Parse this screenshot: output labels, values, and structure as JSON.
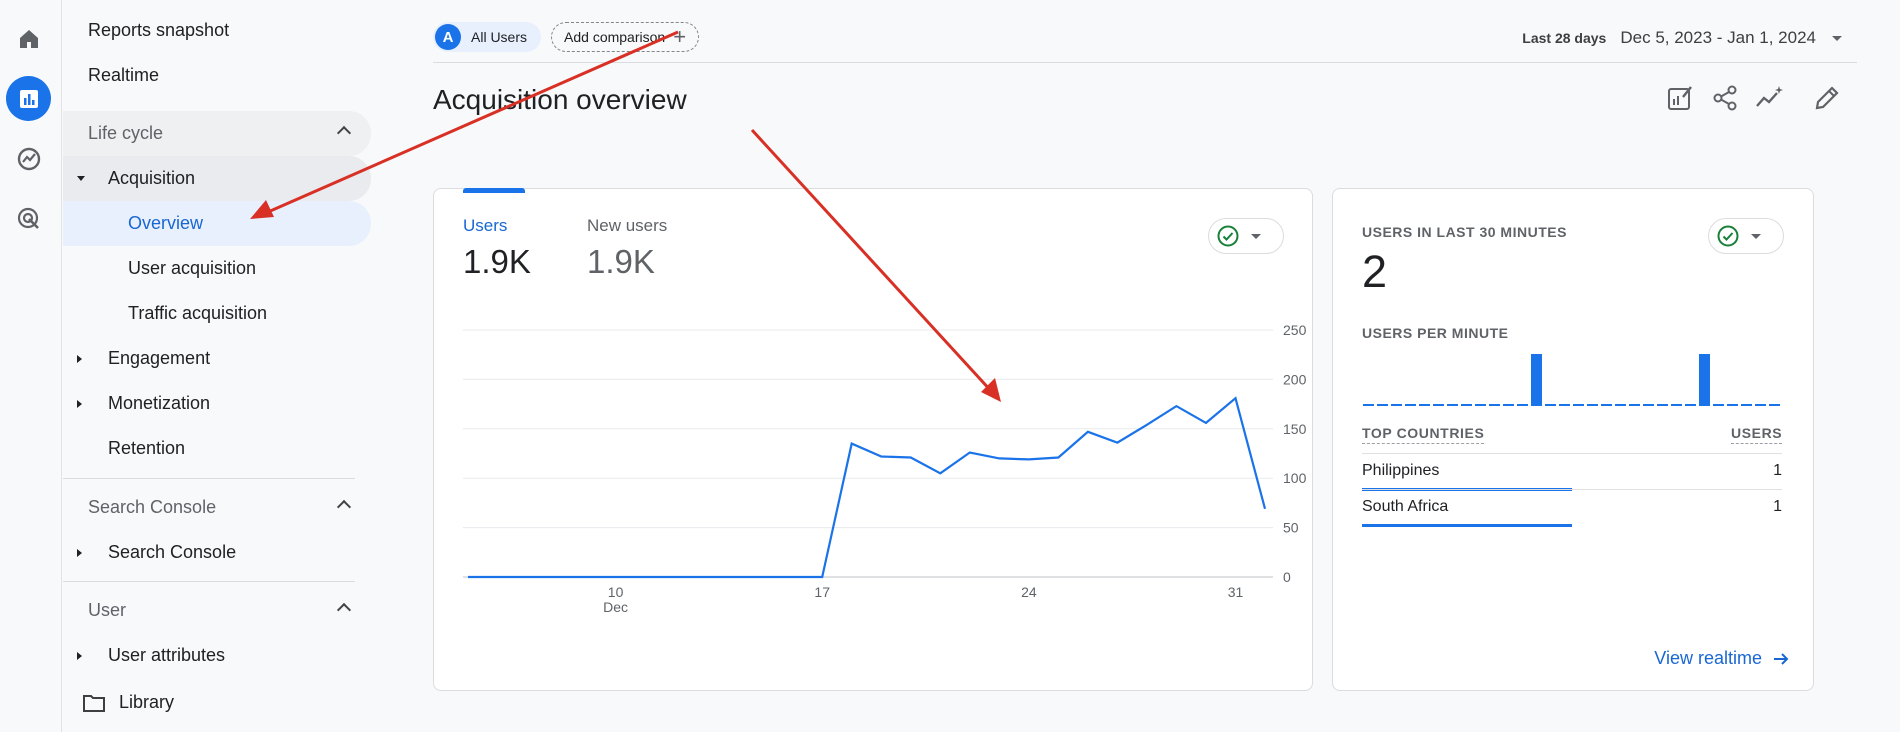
{
  "nav": {
    "reports_snapshot": "Reports snapshot",
    "realtime": "Realtime",
    "lifecycle": "Life cycle",
    "acquisition": "Acquisition",
    "overview": "Overview",
    "user_acquisition": "User acquisition",
    "traffic_acquisition": "Traffic acquisition",
    "engagement": "Engagement",
    "monetization": "Monetization",
    "retention": "Retention",
    "search_console_section": "Search Console",
    "search_console_item": "Search Console",
    "user_section": "User",
    "user_attributes": "User attributes",
    "library": "Library"
  },
  "topbar": {
    "avatar_letter": "A",
    "segment": "All Users",
    "add_comparison": "Add comparison",
    "date_label": "Last 28 days",
    "date_value": "Dec 5, 2023 - Jan 1, 2024"
  },
  "page": {
    "title": "Acquisition overview"
  },
  "main_card": {
    "metric1_label": "Users",
    "metric1_value": "1.9K",
    "metric2_label": "New users",
    "metric2_value": "1.9K"
  },
  "chart_data": {
    "type": "line",
    "series": [
      {
        "values": [
          0,
          0,
          0,
          0,
          0,
          0,
          0,
          0,
          0,
          0,
          0,
          0,
          0,
          135,
          122,
          121,
          105,
          126,
          120,
          119,
          121,
          147,
          136,
          154,
          173,
          156,
          181,
          69
        ]
      }
    ],
    "x_tick_labels": [
      "10",
      "17",
      "24",
      "31"
    ],
    "x_tick_index": [
      5,
      12,
      19,
      26
    ],
    "x_sub_label": "Dec",
    "y_tick_labels": [
      "250",
      "200",
      "150",
      "100",
      "50",
      "0"
    ],
    "ylim": [
      0,
      250
    ],
    "color": "#1a73e8"
  },
  "realtime_card": {
    "users_label": "USERS IN LAST 30 MINUTES",
    "users_value": "2",
    "per_minute_label": "USERS PER MINUTE",
    "per_minute": [
      0,
      0,
      0,
      0,
      0,
      0,
      0,
      0,
      0,
      0,
      0,
      0,
      1,
      0,
      0,
      0,
      0,
      0,
      0,
      0,
      0,
      0,
      0,
      0,
      1,
      0,
      0,
      0,
      0,
      0
    ],
    "countries_header": "TOP COUNTRIES",
    "users_header": "USERS",
    "rows": [
      {
        "country": "Philippines",
        "users": "1",
        "share": 0.5
      },
      {
        "country": "South Africa",
        "users": "1",
        "share": 0.5
      }
    ],
    "view_realtime": "View realtime"
  },
  "colors": {
    "accent": "#1a73e8",
    "annotation": "#d93025"
  }
}
